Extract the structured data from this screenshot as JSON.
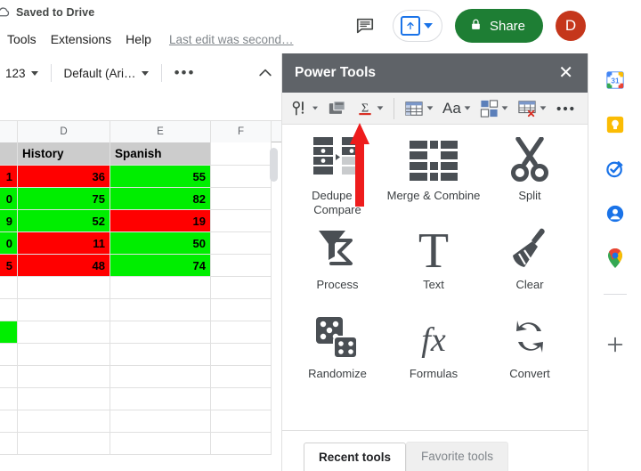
{
  "doc_header": {
    "save_status": "Saved to Drive",
    "cloud_icon": "cloud-saved-icon",
    "menus": [
      {
        "label": "Tools",
        "name": "menu-tools"
      },
      {
        "label": "Extensions",
        "name": "menu-extensions"
      },
      {
        "label": "Help",
        "name": "menu-help"
      }
    ],
    "last_edit": "Last edit was second…"
  },
  "header_actions": {
    "comment_icon": "comment-icon",
    "upload_icon": "upload-arrow-icon",
    "upload_caret_icon": "chevron-down-icon",
    "share_label": "Share",
    "share_lock_icon": "lock-icon",
    "share_color": "#1e7e34",
    "avatar_initial": "D",
    "avatar_color": "#c5361b"
  },
  "toolbar": {
    "number_format": "123",
    "font_name": "Default (Ari…",
    "more_label": "•••",
    "collapse_icon": "chevron-up-icon"
  },
  "spreadsheet": {
    "column_headers": [
      "D",
      "E",
      "F"
    ],
    "rows": [
      {
        "c": "",
        "d": "History",
        "e": "Spanish",
        "kind": "header"
      },
      {
        "c": "1",
        "d": "36",
        "e": "55",
        "d_color": "#ff0000",
        "e_color": "#00ee00",
        "c_color": "#ff0000"
      },
      {
        "c": "0",
        "d": "75",
        "e": "82",
        "d_color": "#00ee00",
        "e_color": "#00ee00",
        "c_color": "#00ee00"
      },
      {
        "c": "9",
        "d": "52",
        "e": "19",
        "d_color": "#00ee00",
        "e_color": "#ff0000",
        "c_color": "#00ee00"
      },
      {
        "c": "0",
        "d": "11",
        "e": "50",
        "d_color": "#ff0000",
        "e_color": "#00ee00",
        "c_color": "#00ee00"
      },
      {
        "c": "5",
        "d": "48",
        "e": "74",
        "d_color": "#ff0000",
        "e_color": "#00ee00",
        "c_color": "#ff0000"
      }
    ],
    "trailing_green_cell": "#00ee00"
  },
  "panel": {
    "title": "Power Tools",
    "close_icon": "close-icon",
    "toolbar_buttons": [
      {
        "name": "pt-tool-hints-icon",
        "icon": "pin-exclamation-icon"
      },
      {
        "name": "pt-sheets-icon",
        "icon": "windows-stack-icon"
      },
      {
        "name": "pt-sum-icon",
        "icon": "sigma-icon"
      },
      {
        "name": "pt-table-icon",
        "icon": "table-grid-icon"
      },
      {
        "name": "pt-text-icon",
        "icon": "aa-text-icon"
      },
      {
        "name": "pt-split-icon",
        "icon": "four-panes-icon"
      },
      {
        "name": "pt-clear-icon",
        "icon": "table-clear-icon"
      },
      {
        "name": "pt-more-icon",
        "icon": "more-dots-icon"
      }
    ],
    "tools": [
      {
        "label": "Dedupe & Compare",
        "icon": "dedupe-compare-icon"
      },
      {
        "label": "Merge & Combine",
        "icon": "merge-combine-icon"
      },
      {
        "label": "Split",
        "icon": "scissors-icon"
      },
      {
        "label": "Process",
        "icon": "funnel-sigma-icon"
      },
      {
        "label": "Text",
        "icon": "letter-t-icon"
      },
      {
        "label": "Clear",
        "icon": "broom-icon"
      },
      {
        "label": "Randomize",
        "icon": "dice-icon"
      },
      {
        "label": "Formulas",
        "icon": "fx-icon"
      },
      {
        "label": "Convert",
        "icon": "convert-arrows-icon"
      }
    ],
    "tabs": [
      {
        "label": "Recent tools",
        "active": true
      },
      {
        "label": "Favorite tools",
        "active": false
      }
    ]
  },
  "rail": {
    "items": [
      {
        "name": "google-calendar-icon",
        "label": "Calendar"
      },
      {
        "name": "google-keep-icon",
        "label": "Keep"
      },
      {
        "name": "google-tasks-icon",
        "label": "Tasks"
      },
      {
        "name": "google-contacts-icon",
        "label": "Contacts"
      },
      {
        "name": "google-maps-icon",
        "label": "Maps"
      }
    ],
    "add_label": "+"
  },
  "annotation": {
    "arrow_color": "#ee1c1c",
    "arrow_name": "red-up-arrow-annotation"
  }
}
